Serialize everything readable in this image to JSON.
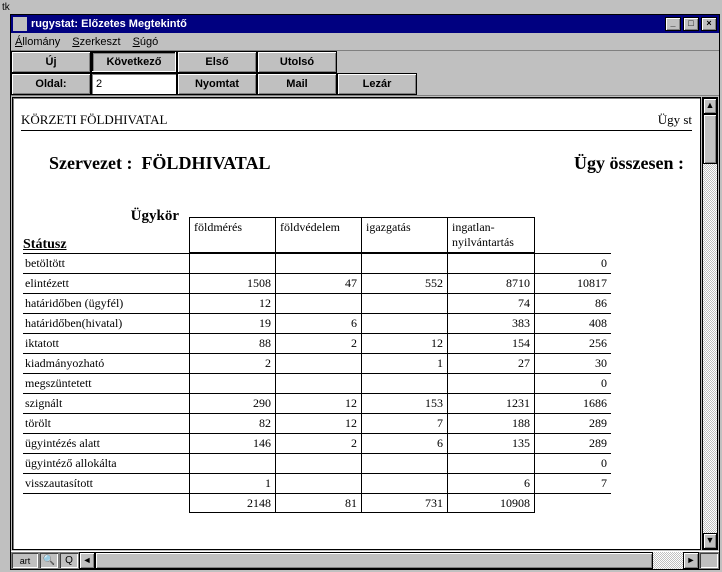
{
  "back_label": "tk",
  "window": {
    "title": "rugystat: Előzetes Megtekintő"
  },
  "menubar": {
    "items": [
      "Állomány",
      "Szerkeszt",
      "Súgó"
    ]
  },
  "toolbar": {
    "uj": "Új",
    "kovetkezo": "Következő",
    "elso": "Első",
    "utolso": "Utolsó",
    "oldal_label": "Oldal:",
    "page_value": "2",
    "nyomtat": "Nyomtat",
    "mail": "Mail",
    "lezar": "Lezár"
  },
  "report": {
    "header_left": "KÖRZETI FÖLDHIVATAL",
    "header_right": "Ügy st",
    "org_label": "Szervezet :",
    "org_value": "FÖLDHIVATAL",
    "total_label": "Ügy összesen :",
    "col_group_label": "Ügykör",
    "status_label": "Státusz",
    "columns": [
      "földmérés",
      "földvédelem",
      "igazgatás",
      "ingatlan-nyilvántartás"
    ],
    "rows": [
      {
        "label": "betöltött",
        "cells": [
          "",
          "",
          "",
          ""
        ],
        "total": "0"
      },
      {
        "label": "elintézett",
        "cells": [
          "1508",
          "47",
          "552",
          "8710"
        ],
        "total": "10817"
      },
      {
        "label": "határidőben (ügyfél)",
        "cells": [
          "12",
          "",
          "",
          "74"
        ],
        "total": "86"
      },
      {
        "label": "határidőben(hivatal)",
        "cells": [
          "19",
          "6",
          "",
          "383"
        ],
        "total": "408"
      },
      {
        "label": "iktatott",
        "cells": [
          "88",
          "2",
          "12",
          "154"
        ],
        "total": "256"
      },
      {
        "label": "kiadmányozható",
        "cells": [
          "2",
          "",
          "1",
          "27"
        ],
        "total": "30"
      },
      {
        "label": "megszüntetett",
        "cells": [
          "",
          "",
          "",
          ""
        ],
        "total": "0"
      },
      {
        "label": "szignált",
        "cells": [
          "290",
          "12",
          "153",
          "1231"
        ],
        "total": "1686"
      },
      {
        "label": "törölt",
        "cells": [
          "82",
          "12",
          "7",
          "188"
        ],
        "total": "289"
      },
      {
        "label": "ügyintézés alatt",
        "cells": [
          "146",
          "2",
          "6",
          "135"
        ],
        "total": "289"
      },
      {
        "label": "ügyintéző allokálta",
        "cells": [
          "",
          "",
          "",
          ""
        ],
        "total": "0"
      },
      {
        "label": "visszautasított",
        "cells": [
          "1",
          "",
          "",
          "6"
        ],
        "total": "7"
      }
    ],
    "footer": {
      "cells": [
        "2148",
        "81",
        "731",
        "10908"
      ],
      "total": ""
    }
  },
  "status_label": "art"
}
